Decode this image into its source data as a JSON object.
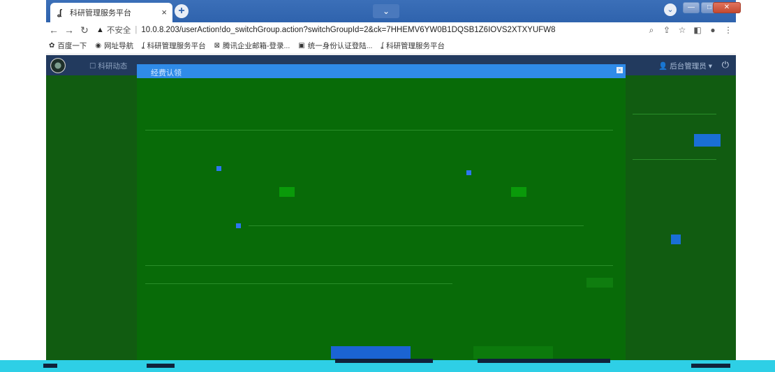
{
  "browser": {
    "tab_title": "科研管理服务平台",
    "tab_close": "×",
    "new_tab": "+",
    "tab_search": "⌄",
    "address": {
      "security_label": "不安全",
      "separator": "|",
      "url": "10.0.8.203/userAction!do_switchGroup.action?switchGroupId=2&ck=7HHEMV6YW0B1DQSB1Z6IOVS2XTXYUFW8"
    },
    "bookmarks": [
      {
        "label": "百度一下",
        "icon": "paw-icon"
      },
      {
        "label": "网址导航",
        "icon": "compass-icon"
      },
      {
        "label": "科研管理服务平台",
        "icon": "flame-icon"
      },
      {
        "label": "腾讯企业邮箱-登录...",
        "icon": "mail-icon"
      },
      {
        "label": "统一身份认证登陆...",
        "icon": "doc-icon"
      },
      {
        "label": "科研管理服务平台",
        "icon": "flame-icon"
      }
    ]
  },
  "app": {
    "nav": {
      "item_1": "科研动态",
      "user_menu": "后台管理员"
    }
  },
  "modal": {
    "title": "经费认领"
  },
  "colors": {
    "accent": "#2f8be8",
    "nav_bg": "#223a5e",
    "noise_green": "#086b08",
    "noise_cyan": "#2ecfe6"
  }
}
